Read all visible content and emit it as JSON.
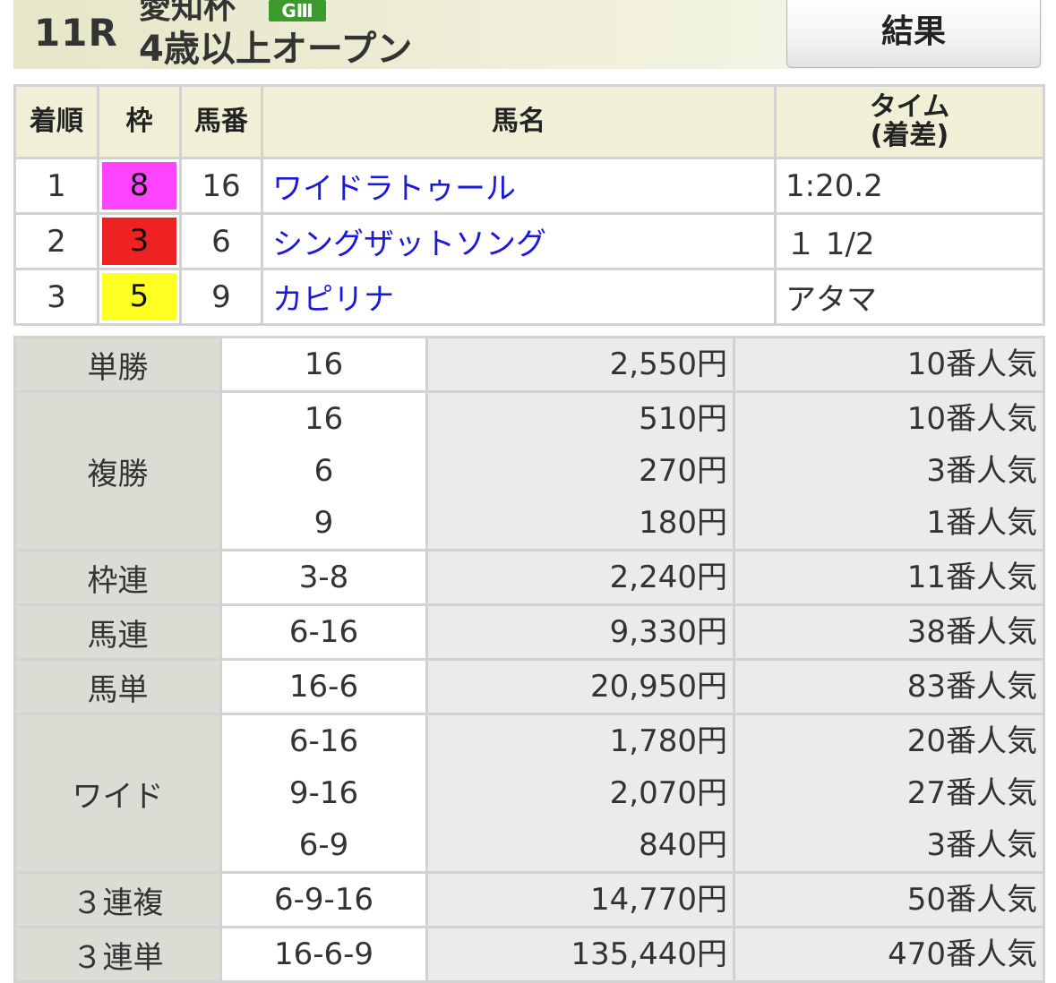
{
  "header": {
    "race_number": "11R",
    "race_name": "愛知杯",
    "grade": "GⅢ",
    "race_condition": "4歳以上オープン",
    "result_button_label": "結果"
  },
  "results": {
    "headers": {
      "rank": "着順",
      "gate": "枠",
      "horse_no": "馬番",
      "horse_name": "馬名",
      "time_line1": "タイム",
      "time_line2": "(着差)"
    },
    "rows": [
      {
        "rank": "1",
        "gate": "8",
        "gate_color": "#ff44ff",
        "horse_no": "16",
        "horse_name": "ワイドラトゥール",
        "time": "1:20.2"
      },
      {
        "rank": "2",
        "gate": "3",
        "gate_color": "#ee2222",
        "horse_no": "6",
        "horse_name": "シングザットソング",
        "time": "１ 1/2"
      },
      {
        "rank": "3",
        "gate": "5",
        "gate_color": "#ffff22",
        "horse_no": "9",
        "horse_name": "カピリナ",
        "time": "アタマ"
      }
    ]
  },
  "payouts": [
    {
      "type": "単勝",
      "entries": [
        {
          "combo": "16",
          "amount": "2,550円",
          "popularity": "10番人気"
        }
      ]
    },
    {
      "type": "複勝",
      "entries": [
        {
          "combo": "16",
          "amount": "510円",
          "popularity": "10番人気"
        },
        {
          "combo": "6",
          "amount": "270円",
          "popularity": "3番人気"
        },
        {
          "combo": "9",
          "amount": "180円",
          "popularity": "1番人気"
        }
      ]
    },
    {
      "type": "枠連",
      "entries": [
        {
          "combo": "3-8",
          "amount": "2,240円",
          "popularity": "11番人気"
        }
      ]
    },
    {
      "type": "馬連",
      "entries": [
        {
          "combo": "6-16",
          "amount": "9,330円",
          "popularity": "38番人気"
        }
      ]
    },
    {
      "type": "馬単",
      "entries": [
        {
          "combo": "16-6",
          "amount": "20,950円",
          "popularity": "83番人気"
        }
      ]
    },
    {
      "type": "ワイド",
      "entries": [
        {
          "combo": "6-16",
          "amount": "1,780円",
          "popularity": "20番人気"
        },
        {
          "combo": "9-16",
          "amount": "2,070円",
          "popularity": "27番人気"
        },
        {
          "combo": "6-9",
          "amount": "840円",
          "popularity": "3番人気"
        }
      ]
    },
    {
      "type": "３連複",
      "entries": [
        {
          "combo": "6-9-16",
          "amount": "14,770円",
          "popularity": "50番人気"
        }
      ]
    },
    {
      "type": "３連単",
      "entries": [
        {
          "combo": "16-6-9",
          "amount": "135,440円",
          "popularity": "470番人気"
        }
      ]
    }
  ]
}
